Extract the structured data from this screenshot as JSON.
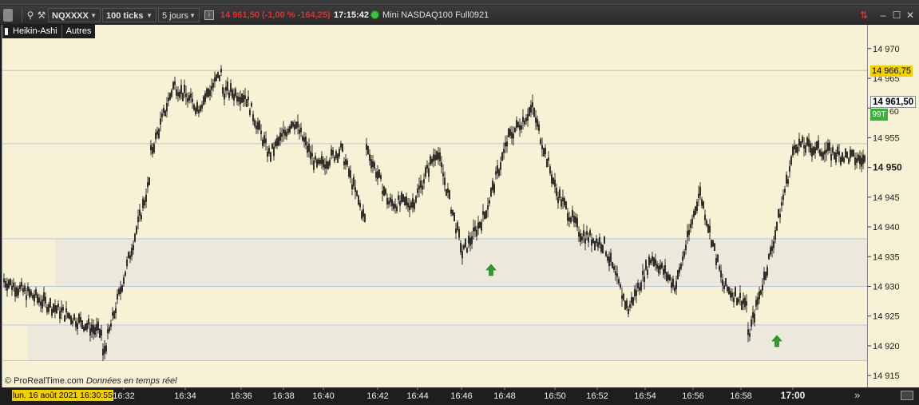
{
  "toolbar": {
    "symbol": "NQXXXX",
    "interval": "100 ticks",
    "period": "5 jours",
    "price_change": "14 961,50 (-1,00 % -164,25)",
    "time": "17:15:42",
    "instrument": "Mini NASDAQ100 Full0921"
  },
  "chart_header": {
    "chart_type": "Heikin-Ashi",
    "other": "Autres"
  },
  "chart_data": {
    "type": "line",
    "title": "",
    "y_ticks": [
      "14 970",
      "14 965",
      "14 960",
      "14 955",
      "14 950",
      "14 945",
      "14 940",
      "14 935",
      "14 930",
      "14 925",
      "14 920",
      "14 915"
    ],
    "ylim": [
      14913,
      14974
    ],
    "x_ticks": [
      "16:32",
      "16:34",
      "16:36",
      "16:38",
      "16:40",
      "16:42",
      "16:44",
      "16:46",
      "16:48",
      "16:50",
      "16:52",
      "16:54",
      "16:56",
      "16:58",
      "17:00"
    ],
    "series": [
      {
        "x": [
          "16:30",
          "16:31",
          "16:31",
          "16:32",
          "16:33",
          "16:33",
          "16:34",
          "16:35",
          "16:35",
          "16:36",
          "16:36",
          "16:37",
          "16:38",
          "16:39",
          "16:40",
          "16:41",
          "16:42",
          "16:42",
          "16:43",
          "16:44",
          "16:45",
          "16:46",
          "16:46",
          "16:47",
          "16:48",
          "16:49",
          "16:50",
          "16:51",
          "16:52",
          "16:53",
          "16:54",
          "16:55",
          "16:56",
          "16:57",
          "16:58",
          "16:58",
          "16:59",
          "17:00",
          "17:01"
        ],
        "values": [
          14931,
          14922,
          14918,
          14933,
          14948,
          14952,
          14964,
          14960,
          14960,
          14966,
          14963,
          14962,
          14952,
          14958,
          14950,
          14953,
          14941,
          14954,
          14944,
          14944,
          14953,
          14937,
          14935,
          14942,
          14955,
          14960,
          14946,
          14939,
          14937,
          14926,
          14935,
          14930,
          14946,
          14930,
          14927,
          14921,
          14936,
          14954,
          14951
        ]
      }
    ],
    "horizontal_lines": [
      14954,
      14938,
      14930,
      14923.5,
      14917.5
    ],
    "zones": [
      [
        14930,
        14938
      ],
      [
        14917.5,
        14923.5
      ]
    ],
    "signals_up_at": [
      "16:47",
      "16:59"
    ]
  },
  "yaxis": {
    "last_price": "14 961,50",
    "ask_label": "14 966,75",
    "volume_badge": "99T",
    "partial_tick": "60",
    "bold_level": "14 950"
  },
  "xaxis": {
    "date": "lun. 16 août 2021 16:30:55",
    "bold_tick": "17:00"
  },
  "footer": {
    "copyright": "© ProRealTime.com",
    "realtime": "Données en temps réel"
  },
  "colors": {
    "chart_bg": "#f7f2d6",
    "candle": "#000000",
    "zone": "#ece9dc",
    "zone_line": "#b8c6de",
    "arrow": "#2e9b2e",
    "ask_bg": "#f0d000",
    "last_bg": "#ffffff",
    "badge_bg": "#3fae3f"
  }
}
